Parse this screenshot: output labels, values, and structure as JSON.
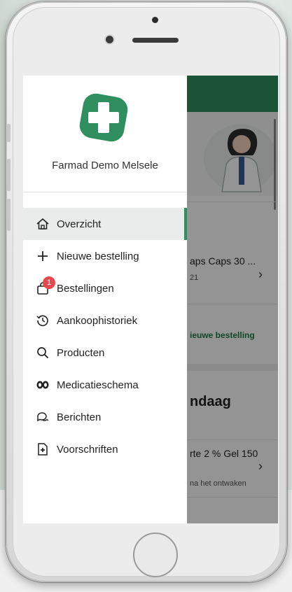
{
  "drawer": {
    "store_name": "Farmad Demo Melsele",
    "menu": [
      {
        "label": "Overzicht",
        "icon": "home-icon",
        "active": true
      },
      {
        "label": "Nieuwe bestelling",
        "icon": "plus-icon"
      },
      {
        "label": "Bestellingen",
        "icon": "bag-icon",
        "badge": "1"
      },
      {
        "label": "Aankoophistoriek",
        "icon": "history-icon"
      },
      {
        "label": "Producten",
        "icon": "search-icon"
      },
      {
        "label": "Medicatieschema",
        "icon": "pills-icon"
      },
      {
        "label": "Berichten",
        "icon": "chat-icon"
      },
      {
        "label": "Voorschriften",
        "icon": "prescription-icon"
      }
    ]
  },
  "background_app": {
    "product_title": "aps Caps 30 ...",
    "product_sub": "21",
    "new_order_link": "ieuwe bestelling",
    "section_heading": "ndaag",
    "med_title": "rte 2 % Gel 150",
    "med_sub": "na het ontwaken"
  },
  "colors": {
    "brand_green": "#2f8f5f",
    "badge_red": "#e5484d"
  }
}
